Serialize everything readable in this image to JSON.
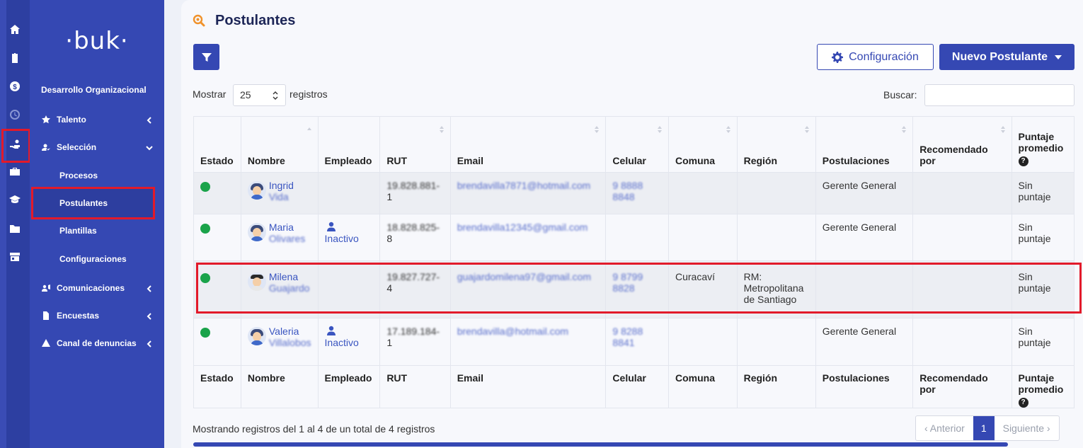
{
  "brand": {
    "logo": "·buk·",
    "accent": "#3548b3",
    "highlight": "#e21a2a"
  },
  "rail": {
    "icons": [
      "home-icon",
      "clipboard-icon",
      "dollar-icon",
      "clock-icon",
      "hand-users-icon",
      "briefcase-icon",
      "graduation-cap-icon",
      "folder-icon",
      "store-icon"
    ]
  },
  "sidebar": {
    "section": "Desarrollo Organizacional",
    "items": [
      {
        "label": "Talento",
        "icon": "star-icon"
      },
      {
        "label": "Selección",
        "icon": "user-check-icon"
      },
      {
        "label": "Comunicaciones",
        "icon": "megaphone-users-icon"
      },
      {
        "label": "Encuestas",
        "icon": "document-icon"
      },
      {
        "label": "Canal de denuncias",
        "icon": "warning-icon"
      }
    ],
    "subitems": [
      {
        "label": "Procesos"
      },
      {
        "label": "Postulantes"
      },
      {
        "label": "Plantillas"
      },
      {
        "label": "Configuraciones"
      }
    ]
  },
  "page": {
    "title": "Postulantes",
    "config_label": "Configuración",
    "new_label": "Nuevo Postulante",
    "show_label": "Mostrar",
    "show_value": "25",
    "records_label": "registros",
    "search_label": "Buscar:",
    "search_value": ""
  },
  "table": {
    "headers": [
      "Estado",
      "Nombre",
      "Empleado",
      "RUT",
      "Email",
      "Celular",
      "Comuna",
      "Región",
      "Postulaciones",
      "Recomendado por",
      "Puntaje promedio"
    ],
    "rows": [
      {
        "name": "Ingrid",
        "surname": "Vida",
        "employee": "",
        "rut": "19.828.881-",
        "rut2": "1",
        "email": "brendavilla7871@hotmail.com",
        "phone": "9 8888",
        "phone2": "8848",
        "comuna": "",
        "region": "",
        "postulaciones": "Gerente General",
        "recomendado": "",
        "puntaje": "Sin puntaje"
      },
      {
        "name": "Maria",
        "surname": "Olivares",
        "employee": "Inactivo",
        "rut": "18.828.825-",
        "rut2": "8",
        "email": "brendavilla12345@gmail.com",
        "phone": "",
        "phone2": "",
        "comuna": "",
        "region": "",
        "postulaciones": "Gerente General",
        "recomendado": "",
        "puntaje": "Sin puntaje"
      },
      {
        "name": "Milena",
        "surname": "Guajardo",
        "employee": "",
        "rut": "19.827.727-",
        "rut2": "4",
        "email": "guajardomilena97@gmail.com",
        "phone": "9 8799",
        "phone2": "8828",
        "comuna": "Curacaví",
        "region": "RM: Metropolitana de Santiago",
        "postulaciones": "",
        "recomendado": "",
        "puntaje": "Sin puntaje"
      },
      {
        "name": "Valeria",
        "surname": "Villalobos",
        "employee": "Inactivo",
        "rut": "17.189.184-",
        "rut2": "1",
        "email": "brendavilla@hotmail.com",
        "phone": "9 8288",
        "phone2": "8841",
        "comuna": "",
        "region": "",
        "postulaciones": "Gerente General",
        "recomendado": "",
        "puntaje": "Sin puntaje"
      }
    ]
  },
  "footer": {
    "info": "Mostrando registros del 1 al 4 de un total de 4 registros",
    "prev": "‹ Anterior",
    "page": "1",
    "next": "Siguiente ›"
  }
}
